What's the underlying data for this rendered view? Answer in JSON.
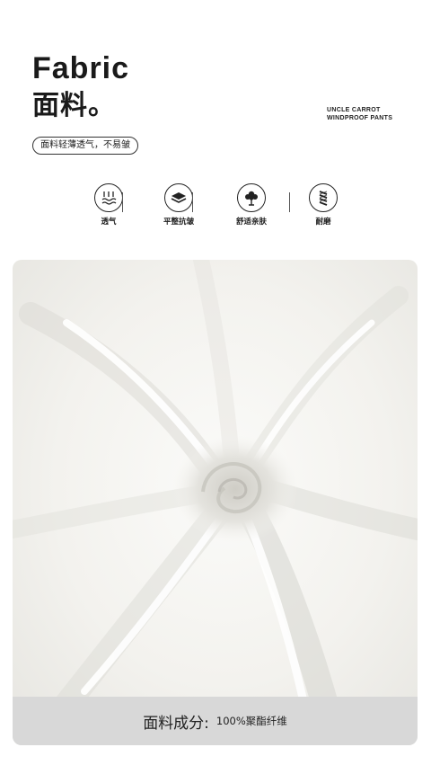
{
  "header": {
    "title_en": "Fabric",
    "title_cn": "面料。",
    "brand_line1": "UNCLE CARROT",
    "brand_line2": "WINDPROOF PANTS",
    "tagline": "面料轻薄透气，不易皱"
  },
  "features": [
    {
      "label": "透气",
      "icon": "breathable-icon"
    },
    {
      "label": "平整抗皱",
      "icon": "wrinkle-resistant-icon"
    },
    {
      "label": "舒适亲肤",
      "icon": "cotton-icon"
    },
    {
      "label": "耐磨",
      "icon": "durable-icon"
    }
  ],
  "composition": {
    "label": "面料成分:",
    "value": "100%聚酯纤维"
  },
  "colors": {
    "text": "#1a1a1a",
    "fabric": "#f4f3ef",
    "bar": "#d8d8d8"
  }
}
